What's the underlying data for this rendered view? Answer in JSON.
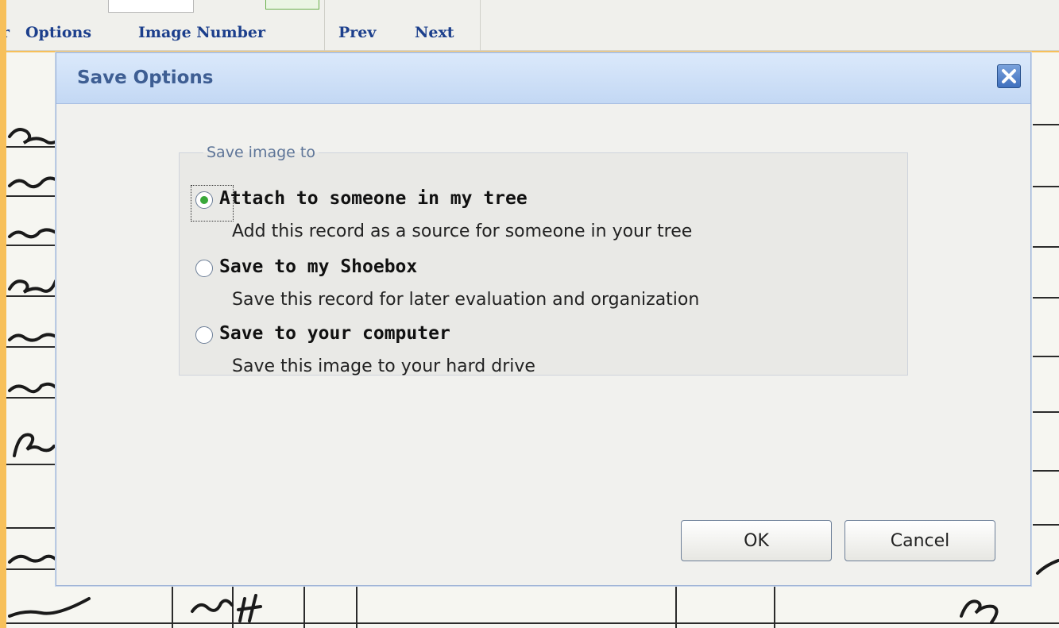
{
  "toolbar": {
    "options_label": "Options",
    "options_prefix": "r",
    "image_number_label": "Image Number",
    "prev_label": "Prev",
    "next_label": "Next"
  },
  "dialog": {
    "title": "Save Options",
    "group_legend": "Save image to",
    "options": [
      {
        "label": "Attach to someone in my tree",
        "description": "Add this record as a source for someone in your tree",
        "checked": true
      },
      {
        "label": "Save to my Shoebox",
        "description": "Save this record for later evaluation and organization",
        "checked": false
      },
      {
        "label": "Save to your computer",
        "description": "Save this image to your hard drive",
        "checked": false
      }
    ],
    "ok_label": "OK",
    "cancel_label": "Cancel"
  },
  "colors": {
    "frame": "#f7c05a",
    "dialog_title": "#3e5e93",
    "link": "#1c3f8c",
    "radio_checked": "#39a83a"
  }
}
